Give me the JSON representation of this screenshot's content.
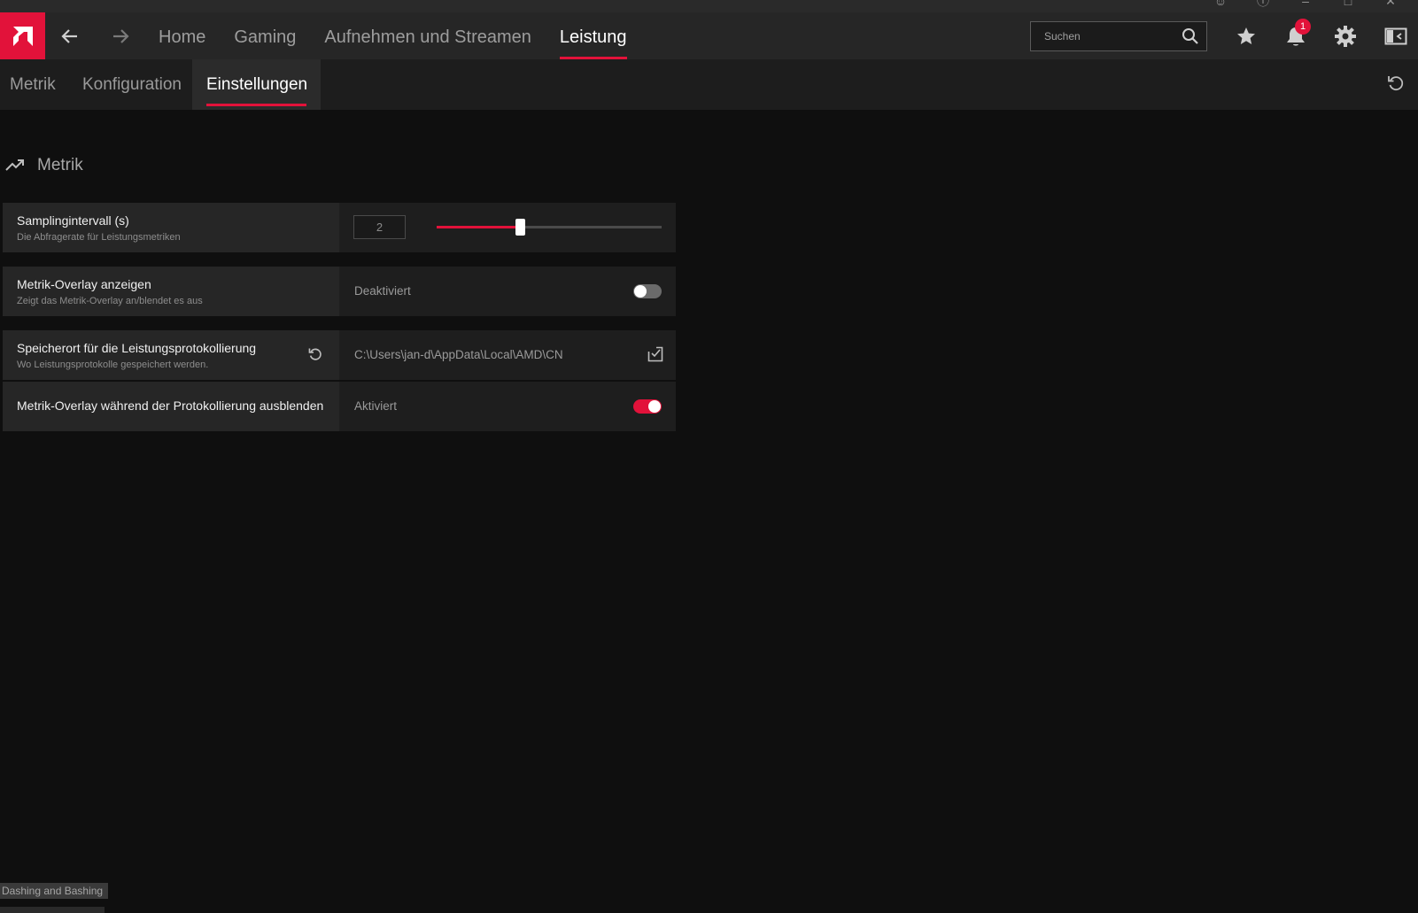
{
  "colors": {
    "accent": "#e2123a",
    "background": "#0f0f0f",
    "panel": "#262626"
  },
  "nav": {
    "back_icon": "arrow-left-icon",
    "forward_icon": "arrow-right-icon",
    "items": [
      {
        "label": "Home"
      },
      {
        "label": "Gaming"
      },
      {
        "label": "Aufnehmen und Streamen"
      },
      {
        "label": "Leistung",
        "active": true
      }
    ]
  },
  "search": {
    "placeholder": "Suchen",
    "value": ""
  },
  "notifications": {
    "count": "1"
  },
  "subtabs": [
    {
      "label": "Metrik"
    },
    {
      "label": "Konfiguration"
    },
    {
      "label": "Einstellungen",
      "active": true
    }
  ],
  "section": {
    "title": "Metrik",
    "icon": "trending-up-icon"
  },
  "settings": {
    "sampling": {
      "title": "Samplingintervall (s)",
      "description": "Die Abfragerate für Leistungsmetriken",
      "value": "2",
      "slider_fraction": 0.37
    },
    "overlay": {
      "title": "Metrik-Overlay anzeigen",
      "description": "Zeigt das Metrik-Overlay an/blendet es aus",
      "state_label": "Deaktiviert",
      "enabled": false
    },
    "log_location": {
      "title": "Speicherort für die Leistungsprotokollierung",
      "description": "Wo Leistungsprotokolle gespeichert werden.",
      "path": "C:\\Users\\jan-d\\AppData\\Local\\AMD\\CN"
    },
    "hide_overlay": {
      "title": "Metrik-Overlay während der Protokollierung ausblenden",
      "state_label": "Aktiviert",
      "enabled": true
    }
  },
  "footer": {
    "tag": "Dashing and Bashing"
  }
}
